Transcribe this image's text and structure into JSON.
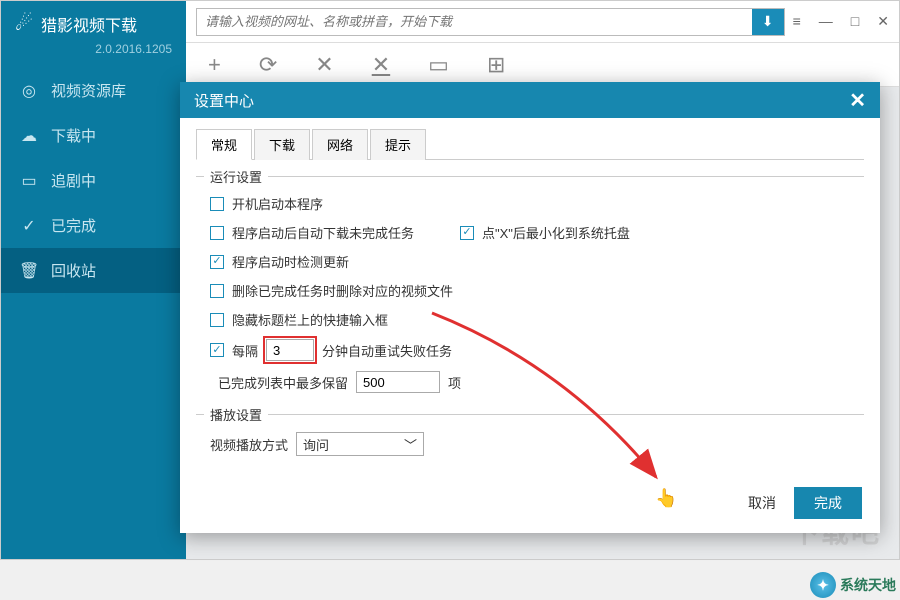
{
  "app": {
    "title": "猎影视频下载",
    "version": "2.0.2016.1205"
  },
  "search": {
    "placeholder": "请输入视频的网址、名称或拼音，开始下载"
  },
  "nav": {
    "items": [
      {
        "label": "视频资源库"
      },
      {
        "label": "下载中"
      },
      {
        "label": "追剧中"
      },
      {
        "label": "已完成"
      },
      {
        "label": "回收站"
      }
    ]
  },
  "toolbar_icons": {
    "add": "+",
    "refresh": "⟳",
    "close": "✕",
    "closeAll": "✕",
    "window": "▭",
    "grid": "⊞"
  },
  "dialog": {
    "title": "设置中心",
    "tabs": [
      "常规",
      "下载",
      "网络",
      "提示"
    ],
    "groups": {
      "run": {
        "legend": "运行设置"
      },
      "play": {
        "legend": "播放设置"
      }
    },
    "opts": {
      "startOnBoot": "开机启动本程序",
      "resumeOnStart": "程序启动后自动下载未完成任务",
      "minimizeOnX": "点\"X\"后最小化到系统托盘",
      "checkUpdate": "程序启动时检测更新",
      "deleteVideo": "删除已完成任务时删除对应的视频文件",
      "hideQuickInput": "隐藏标题栏上的快捷输入框",
      "retryPrefix": "每隔",
      "retrySuffix": "分钟自动重试失败任务",
      "retryValue": "3",
      "keepPrefix": "已完成列表中最多保留",
      "keepSuffix": "项",
      "keepValue": "500",
      "playModeLabel": "视频播放方式",
      "playModeValue": "询问"
    },
    "buttons": {
      "cancel": "取消",
      "ok": "完成"
    }
  },
  "watermark": "下载吧",
  "footer": "系统天地"
}
